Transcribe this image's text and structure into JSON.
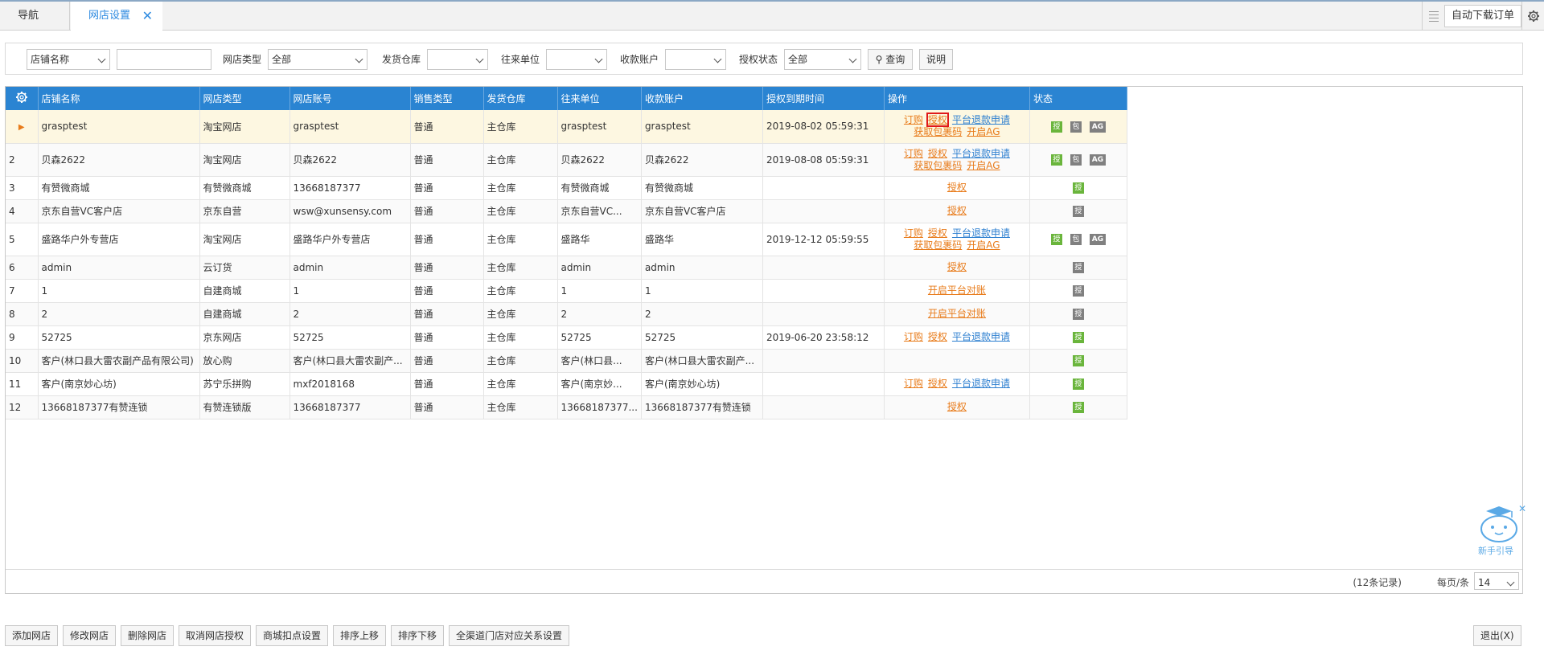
{
  "tabs": {
    "nav": "导航",
    "active": "网店设置",
    "close": "✕"
  },
  "toolbar": {
    "auto_download": "自动下载订单"
  },
  "filter": {
    "field_select": "店铺名称",
    "keyword": "",
    "shop_type_label": "网店类型",
    "shop_type_value": "全部",
    "warehouse_label": "发货仓库",
    "warehouse_value": "",
    "partner_label": "往来单位",
    "partner_value": "",
    "account_label": "收款账户",
    "account_value": "",
    "auth_label": "授权状态",
    "auth_value": "全部",
    "query_button": "查询",
    "help_button": "说明"
  },
  "grid": {
    "headers": [
      "店铺名称",
      "网店类型",
      "网店账号",
      "销售类型",
      "发货仓库",
      "往来单位",
      "收款账户",
      "授权到期时间",
      "操作",
      "状态"
    ],
    "rows": [
      {
        "no": "",
        "name": "grasptest",
        "type": "淘宝网店",
        "account": "grasptest",
        "sale": "普通",
        "wh": "主仓库",
        "partner": "grasptest",
        "pay": "grasptest",
        "expire": "2019-08-02 05:59:31"
      },
      {
        "no": "2",
        "name": "贝森2622",
        "type": "淘宝网店",
        "account": "贝森2622",
        "sale": "普通",
        "wh": "主仓库",
        "partner": "贝森2622",
        "pay": "贝森2622",
        "expire": "2019-08-08 05:59:31"
      },
      {
        "no": "3",
        "name": "有赞微商城",
        "type": "有赞微商城",
        "account": "13668187377",
        "sale": "普通",
        "wh": "主仓库",
        "partner": "有赞微商城",
        "pay": "有赞微商城",
        "expire": ""
      },
      {
        "no": "4",
        "name": "京东自营VC客户店",
        "type": "京东自营",
        "account": "wsw@xunsensy.com",
        "sale": "普通",
        "wh": "主仓库",
        "partner": "京东自营VC...",
        "pay": "京东自营VC客户店",
        "expire": ""
      },
      {
        "no": "5",
        "name": "盛路华户外专营店",
        "type": "淘宝网店",
        "account": "盛路华户外专营店",
        "sale": "普通",
        "wh": "主仓库",
        "partner": "盛路华",
        "pay": "盛路华",
        "expire": "2019-12-12 05:59:55"
      },
      {
        "no": "6",
        "name": "admin",
        "type": "云订货",
        "account": "admin",
        "sale": "普通",
        "wh": "主仓库",
        "partner": "admin",
        "pay": "admin",
        "expire": ""
      },
      {
        "no": "7",
        "name": "1",
        "type": "自建商城",
        "account": "1",
        "sale": "普通",
        "wh": "主仓库",
        "partner": "1",
        "pay": "1",
        "expire": ""
      },
      {
        "no": "8",
        "name": "2",
        "type": "自建商城",
        "account": "2",
        "sale": "普通",
        "wh": "主仓库",
        "partner": "2",
        "pay": "2",
        "expire": ""
      },
      {
        "no": "9",
        "name": "52725",
        "type": "京东网店",
        "account": "52725",
        "sale": "普通",
        "wh": "主仓库",
        "partner": "52725",
        "pay": "52725",
        "expire": "2019-06-20 23:58:12"
      },
      {
        "no": "10",
        "name": "客户(林口县大雷农副产品有限公司)",
        "type": "放心购",
        "account": "客户(林口县大雷农副产...",
        "sale": "普通",
        "wh": "主仓库",
        "partner": "客户(林口县...",
        "pay": "客户(林口县大雷农副产...",
        "expire": ""
      },
      {
        "no": "11",
        "name": "客户(南京妙心坊)",
        "type": "苏宁乐拼购",
        "account": "mxf2018168",
        "sale": "普通",
        "wh": "主仓库",
        "partner": "客户(南京妙...",
        "pay": "客户(南京妙心坊)",
        "expire": ""
      },
      {
        "no": "12",
        "name": "13668187377有赞连锁",
        "type": "有赞连锁版",
        "account": "13668187377",
        "sale": "普通",
        "wh": "主仓库",
        "partner": "13668187377...",
        "pay": "13668187377有赞连锁",
        "expire": ""
      }
    ],
    "ops": {
      "order": "订购",
      "auth": "授权",
      "refund": "平台退款申请",
      "get_package": "获取包裹码",
      "open_ag": "开启AG",
      "open_recon": "开启平台对账"
    },
    "badges": {
      "auth": "授",
      "pkg": "包",
      "ag": "AG"
    }
  },
  "pager": {
    "records": "(12条记录)",
    "per_page_label": "每页/条",
    "per_page_value": "14"
  },
  "helper": {
    "label": "新手引导",
    "close": "✕"
  },
  "actions": [
    "添加网店",
    "修改网店",
    "删除网店",
    "取消网店授权",
    "商城扣点设置",
    "排序上移",
    "排序下移",
    "全渠道门店对应关系设置"
  ],
  "exit": "退出(X)",
  "colors": {
    "header_bg": "#2a84d2",
    "accent": "#2d8ae0",
    "link_orange": "#e87b1a",
    "selected_row": "#fdf7e1"
  }
}
